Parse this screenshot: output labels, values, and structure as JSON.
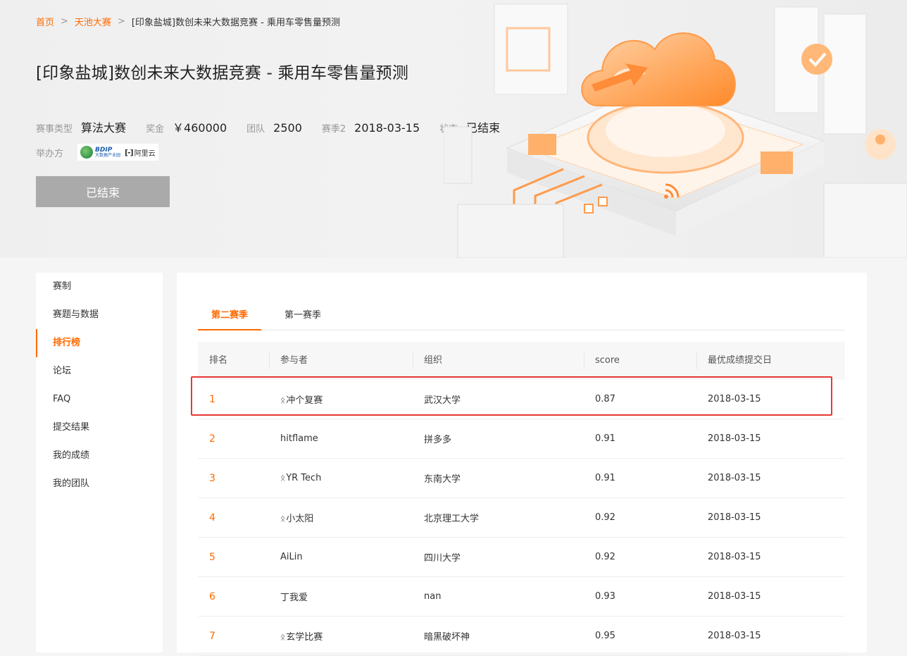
{
  "breadcrumb": {
    "home": "首页",
    "separator": ">",
    "category": "天池大赛",
    "current": "[印象盐城]数创未来大数据竞赛 - 乘用车零售量预测"
  },
  "title": "[印象盐城]数创未来大数据竞赛 - 乘用车零售量预测",
  "meta": [
    {
      "label": "赛事类型",
      "value": "算法大赛"
    },
    {
      "label": "奖金",
      "value": "￥460000"
    },
    {
      "label": "团队",
      "value": "2500"
    },
    {
      "label": "赛季2",
      "value": "2018-03-15"
    },
    {
      "label": "状态",
      "value": "已结束"
    }
  ],
  "organizer": {
    "label": "举办方",
    "logos": [
      "bdip-logo",
      "aliyun-logo"
    ],
    "bdip_text": "BDIP",
    "bdip_sub": "大数据产业园",
    "aliyun_mark": "[-]",
    "aliyun_text": "阿里云"
  },
  "status_button": "已结束",
  "sidebar": {
    "items": [
      {
        "label": "赛制",
        "active": false
      },
      {
        "label": "赛题与数据",
        "active": false
      },
      {
        "label": "排行榜",
        "active": true
      },
      {
        "label": "论坛",
        "active": false
      },
      {
        "label": "FAQ",
        "active": false
      },
      {
        "label": "提交结果",
        "active": false
      },
      {
        "label": "我的成绩",
        "active": false
      },
      {
        "label": "我的团队",
        "active": false
      }
    ]
  },
  "tabs": [
    {
      "label": "第二赛季",
      "active": true
    },
    {
      "label": "第一赛季",
      "active": false
    }
  ],
  "leaderboard": {
    "headers": [
      "排名",
      "参与者",
      "组织",
      "score",
      "最优成绩提交日"
    ],
    "rows": [
      {
        "rank": "1",
        "team_icon": true,
        "participant": "冲个复赛",
        "org": "武汉大学",
        "score": "0.87",
        "date": "2018-03-15"
      },
      {
        "rank": "2",
        "team_icon": false,
        "participant": "hitflame",
        "org": "拼多多",
        "score": "0.91",
        "date": "2018-03-15"
      },
      {
        "rank": "3",
        "team_icon": true,
        "participant": "YR Tech",
        "org": "东南大学",
        "score": "0.91",
        "date": "2018-03-15"
      },
      {
        "rank": "4",
        "team_icon": true,
        "participant": "小太阳",
        "org": "北京理工大学",
        "score": "0.92",
        "date": "2018-03-15"
      },
      {
        "rank": "5",
        "team_icon": false,
        "participant": "AiLin",
        "org": "四川大学",
        "score": "0.92",
        "date": "2018-03-15"
      },
      {
        "rank": "6",
        "team_icon": false,
        "participant": "丁我爱",
        "org": "nan",
        "score": "0.93",
        "date": "2018-03-15"
      },
      {
        "rank": "7",
        "team_icon": true,
        "participant": "玄学比赛",
        "org": "暗黑破坏神",
        "score": "0.95",
        "date": "2018-03-15"
      }
    ],
    "highlighted_row": 0,
    "team_icon_glyph": "ᛟ"
  },
  "colors": {
    "accent": "#ff6a00",
    "highlight_border": "#e53935",
    "disabled_button": "#aaaaaa"
  }
}
